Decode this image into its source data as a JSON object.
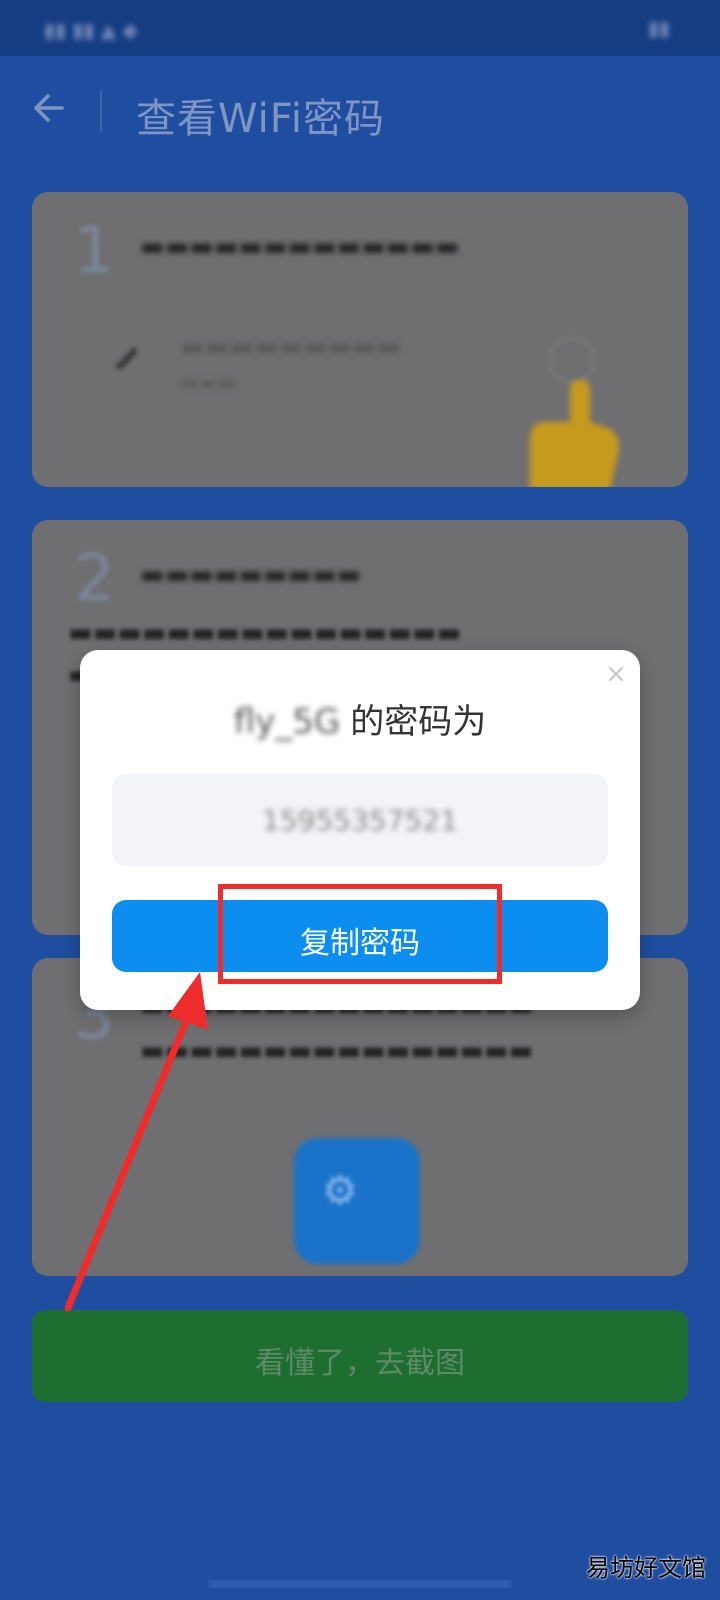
{
  "header": {
    "title": "查看WiFi密码"
  },
  "dialog": {
    "title_ssid": "fly_5G",
    "title_suffix": "的密码为",
    "password": "15955357521",
    "copy_label": "复制密码"
  },
  "background": {
    "bottom_button_label": "看懂了，去截图"
  },
  "watermark": "易坊好文馆",
  "colors": {
    "primary_blue": "#0b8ef0",
    "header_blue": "#1f4ea0",
    "highlight_red": "#ee2c2c",
    "bottom_button_green": "#1d6e30"
  }
}
